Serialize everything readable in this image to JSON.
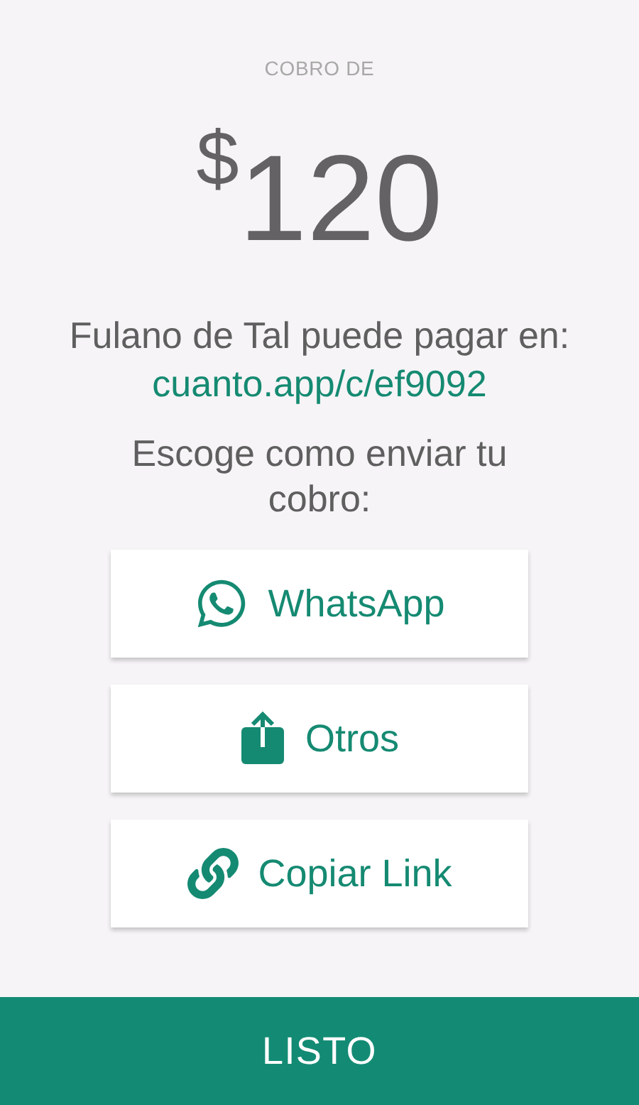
{
  "header": {
    "label": "COBRO DE",
    "currency": "$",
    "amount": "120"
  },
  "payment_message": "Fulano de Tal puede pagar en:",
  "payment_link": "cuanto.app/c/ef9092",
  "prompt": "Escoge como enviar tu cobro:",
  "share_options": [
    {
      "kind": "whatsapp",
      "label": "WhatsApp"
    },
    {
      "kind": "share",
      "label": "Otros"
    },
    {
      "kind": "link",
      "label": "Copiar Link"
    }
  ],
  "done_button": "LISTO"
}
